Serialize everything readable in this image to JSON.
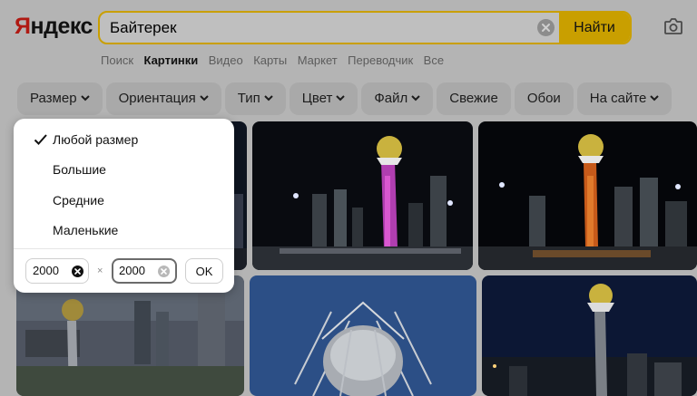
{
  "logo": {
    "first": "Я",
    "rest": "ндекс"
  },
  "search": {
    "query": "Байтерек",
    "button_label": "Найти"
  },
  "nav": [
    {
      "label": "Поиск",
      "active": false
    },
    {
      "label": "Картинки",
      "active": true
    },
    {
      "label": "Видео",
      "active": false
    },
    {
      "label": "Карты",
      "active": false
    },
    {
      "label": "Маркет",
      "active": false
    },
    {
      "label": "Переводчик",
      "active": false
    },
    {
      "label": "Все",
      "active": false
    }
  ],
  "filters": [
    {
      "label": "Размер",
      "dropdown": true
    },
    {
      "label": "Ориентация",
      "dropdown": true
    },
    {
      "label": "Тип",
      "dropdown": true
    },
    {
      "label": "Цвет",
      "dropdown": true
    },
    {
      "label": "Файл",
      "dropdown": true
    },
    {
      "label": "Свежие",
      "dropdown": false
    },
    {
      "label": "Обои",
      "dropdown": false
    },
    {
      "label": "На сайте",
      "dropdown": true
    }
  ],
  "size_dropdown": {
    "options": [
      {
        "label": "Любой размер",
        "selected": true
      },
      {
        "label": "Большие",
        "selected": false
      },
      {
        "label": "Средние",
        "selected": false
      },
      {
        "label": "Маленькие",
        "selected": false
      }
    ],
    "width_value": "2000",
    "height_value": "2000",
    "times_sign": "×",
    "ok_label": "OK"
  },
  "icons": {
    "clear": "clear-icon",
    "camera": "camera-icon",
    "check": "check-icon",
    "chevron": "chevron-down-icon"
  },
  "colors": {
    "accent": "#c99f00",
    "logo_red": "#b01912",
    "overlay_background": "#b4b4b4"
  }
}
